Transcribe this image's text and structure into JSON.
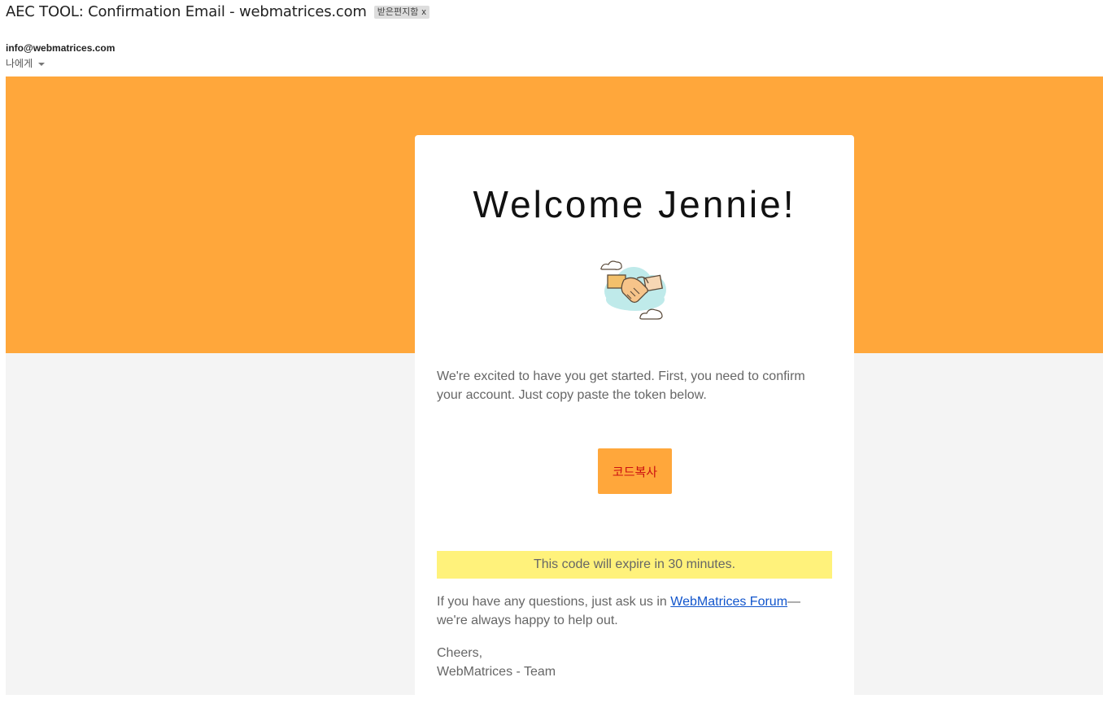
{
  "email": {
    "subject": "AEC TOOL: Confirmation Email - webmatrices.com",
    "label": "받은편지함",
    "label_remove": "x",
    "sender": "info@webmatrices.com",
    "recipient": "나에게"
  },
  "content": {
    "welcome_title": "Welcome Jennie!",
    "intro": "We're excited to have you get started. First, you need to confirm your account. Just copy paste the token below.",
    "copy_button_label": "코드복사",
    "expire_notice": "This code will expire in 30 minutes.",
    "questions_prefix": "If you have any questions, just ask us in ",
    "forum_link_text": "WebMatrices Forum",
    "questions_suffix": "— we're always happy to help out.",
    "cheers": "Cheers,",
    "team": "WebMatrices - Team"
  },
  "colors": {
    "brand_orange": "#ffa73b",
    "expire_yellow": "#fff27b",
    "canvas_grey": "#f4f4f4"
  },
  "icons": {
    "illustration": "handshake-icon"
  }
}
